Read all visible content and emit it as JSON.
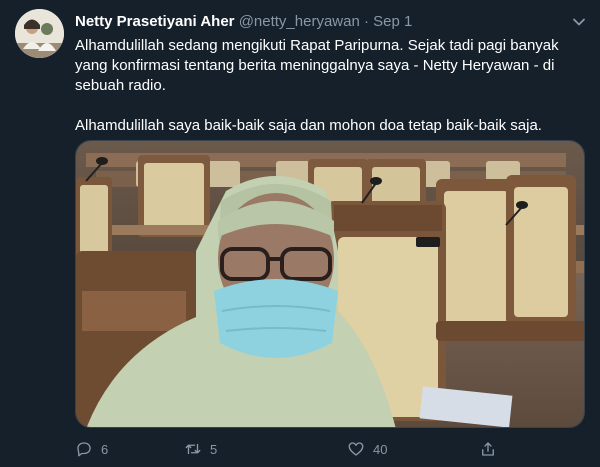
{
  "tweet": {
    "author_name": "Netty Prasetiyani Aher",
    "author_handle": "@netty_heryawan",
    "separator": "·",
    "date": "Sep 1",
    "text_paragraph_1": "Alhamdulillah sedang mengikuti Rapat Paripurna. Sejak tadi pagi banyak yang konfirmasi tentang berita meninggalnya saya - Netty Heryawan - di sebuah radio.",
    "text_paragraph_2": "Alhamdulillah saya baik-baik saja dan mohon doa tetap baik-baik saja."
  },
  "actions": {
    "reply_count": "6",
    "retweet_count": "5",
    "like_count": "40"
  },
  "icons": {
    "more": "chevron-down-icon",
    "reply": "reply-icon",
    "retweet": "retweet-icon",
    "like": "heart-icon",
    "share": "share-icon"
  },
  "colors": {
    "background": "#15202b",
    "secondary_text": "#8899a6",
    "border": "#38444d"
  }
}
